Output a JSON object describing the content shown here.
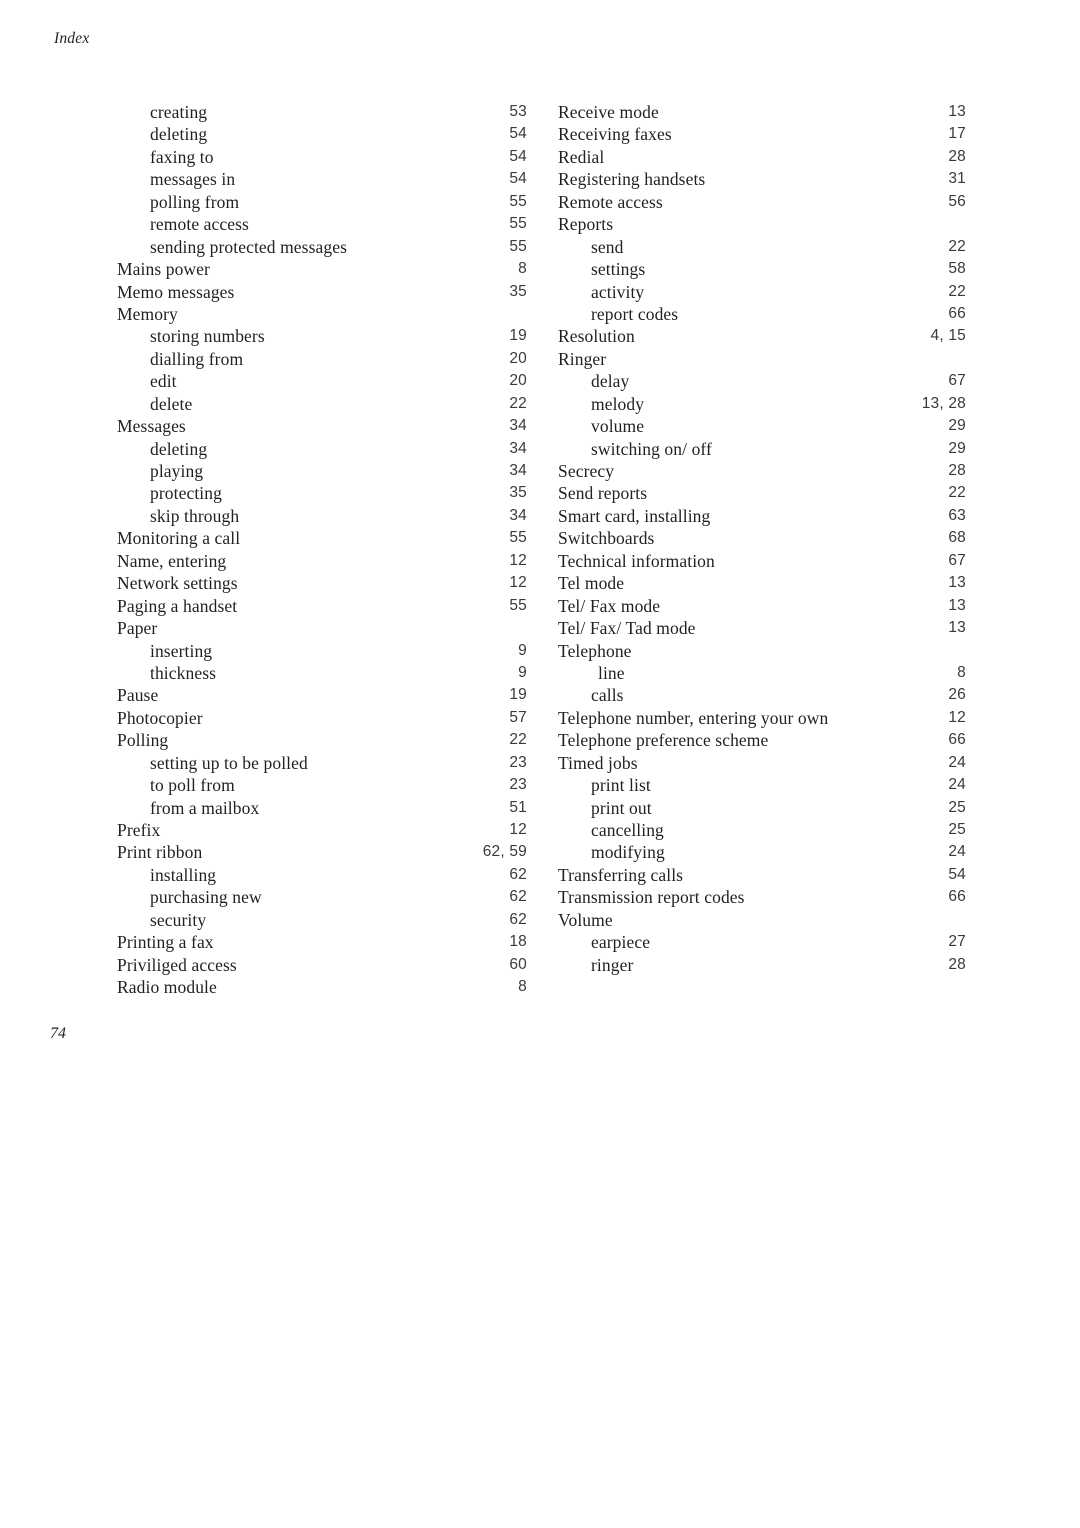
{
  "header": {
    "running_head": "Index"
  },
  "footer": {
    "page_number": "74"
  },
  "index": {
    "left_column": [
      {
        "label": "creating",
        "page": "53",
        "level": 2
      },
      {
        "label": "deleting",
        "page": "54",
        "level": 2
      },
      {
        "label": "faxing to",
        "page": "54",
        "level": 2
      },
      {
        "label": "messages in",
        "page": "54",
        "level": 2
      },
      {
        "label": "polling from",
        "page": "55",
        "level": 2
      },
      {
        "label": "remote access",
        "page": "55",
        "level": 2
      },
      {
        "label": "sending protected messages",
        "page": "55",
        "level": 2
      },
      {
        "label": "Mains power",
        "page": "8",
        "level": 1
      },
      {
        "label": "Memo messages",
        "page": "35",
        "level": 1
      },
      {
        "label": "Memory",
        "page": "",
        "level": 1
      },
      {
        "label": "storing numbers",
        "page": "19",
        "level": 2
      },
      {
        "label": "dialling from",
        "page": "20",
        "level": 2
      },
      {
        "label": "edit",
        "page": "20",
        "level": 2
      },
      {
        "label": "delete",
        "page": "22",
        "level": 2
      },
      {
        "label": "Messages",
        "page": "34",
        "level": 1
      },
      {
        "label": "deleting",
        "page": "34",
        "level": 2
      },
      {
        "label": "playing",
        "page": "34",
        "level": 2
      },
      {
        "label": "protecting",
        "page": "35",
        "level": 2
      },
      {
        "label": "skip through",
        "page": "34",
        "level": 2
      },
      {
        "label": "Monitoring a call",
        "page": "55",
        "level": 1
      },
      {
        "label": "Name, entering",
        "page": "12",
        "level": 1
      },
      {
        "label": "Network settings",
        "page": "12",
        "level": 1
      },
      {
        "label": "Paging a handset",
        "page": "55",
        "level": 1
      },
      {
        "label": "Paper",
        "page": "",
        "level": 1
      },
      {
        "label": "inserting",
        "page": "9",
        "level": 2
      },
      {
        "label": "thickness",
        "page": "9",
        "level": 2
      },
      {
        "label": "Pause",
        "page": "19",
        "level": 1
      },
      {
        "label": "Photocopier",
        "page": "57",
        "level": 1
      },
      {
        "label": "Polling",
        "page": "22",
        "level": 1
      },
      {
        "label": "setting up to be polled",
        "page": "23",
        "level": 2
      },
      {
        "label": "to poll from",
        "page": "23",
        "level": 2
      },
      {
        "label": "from a mailbox",
        "page": "51",
        "level": 2
      },
      {
        "label": "Prefix",
        "page": "12",
        "level": 1
      },
      {
        "label": "Print ribbon",
        "page": "62, 59",
        "level": 1
      },
      {
        "label": "installing",
        "page": "62",
        "level": 2
      },
      {
        "label": "purchasing new",
        "page": "62",
        "level": 2
      },
      {
        "label": "security",
        "page": "62",
        "level": 2
      },
      {
        "label": "Printing a fax",
        "page": "18",
        "level": 1
      },
      {
        "label": "Priviliged access",
        "page": "60",
        "level": 1
      },
      {
        "label": "Radio module",
        "page": "8",
        "level": 1
      }
    ],
    "right_column": [
      {
        "label": "Receive mode",
        "page": "13",
        "level": 1
      },
      {
        "label": "Receiving faxes",
        "page": "17",
        "level": 1
      },
      {
        "label": "Redial",
        "page": "28",
        "level": 1
      },
      {
        "label": "Registering handsets",
        "page": "31",
        "level": 1
      },
      {
        "label": "Remote access",
        "page": "56",
        "level": 1
      },
      {
        "label": "Reports",
        "page": "",
        "level": 1
      },
      {
        "label": "send",
        "page": "22",
        "level": 2
      },
      {
        "label": "settings",
        "page": "58",
        "level": 2
      },
      {
        "label": "activity",
        "page": "22",
        "level": 2
      },
      {
        "label": "report codes",
        "page": "66",
        "level": 2
      },
      {
        "label": "Resolution",
        "page": "4, 15",
        "level": 1
      },
      {
        "label": "Ringer",
        "page": "",
        "level": 1
      },
      {
        "label": "delay",
        "page": "67",
        "level": 2
      },
      {
        "label": "melody",
        "page": "13, 28",
        "level": 2
      },
      {
        "label": "volume",
        "page": "29",
        "level": 2
      },
      {
        "label": "switching on/ off",
        "page": "29",
        "level": 2
      },
      {
        "label": "Secrecy",
        "page": "28",
        "level": 1
      },
      {
        "label": "Send reports",
        "page": "22",
        "level": 1
      },
      {
        "label": "Smart card, installing",
        "page": "63",
        "level": 1
      },
      {
        "label": "Switchboards",
        "page": "68",
        "level": 1
      },
      {
        "label": "Technical information",
        "page": "67",
        "level": 1
      },
      {
        "label": "Tel mode",
        "page": "13",
        "level": 1
      },
      {
        "label": "Tel/ Fax mode",
        "page": "13",
        "level": 1
      },
      {
        "label": "Tel/ Fax/ Tad mode",
        "page": "13",
        "level": 1
      },
      {
        "label": "Telephone",
        "page": "",
        "level": 1
      },
      {
        "label": "line",
        "page": "8",
        "level": 3
      },
      {
        "label": "calls",
        "page": "26",
        "level": 2
      },
      {
        "label": "Telephone number, entering your own",
        "page": "12",
        "level": 1
      },
      {
        "label": "Telephone preference scheme",
        "page": "66",
        "level": 1
      },
      {
        "label": "Timed jobs",
        "page": "24",
        "level": 1
      },
      {
        "label": "print list",
        "page": "24",
        "level": 2
      },
      {
        "label": "print out",
        "page": "25",
        "level": 2
      },
      {
        "label": "cancelling",
        "page": "25",
        "level": 2
      },
      {
        "label": "modifying",
        "page": "24",
        "level": 2
      },
      {
        "label": "Transferring calls",
        "page": "54",
        "level": 1
      },
      {
        "label": "Transmission report codes",
        "page": "66",
        "level": 1
      },
      {
        "label": "Volume",
        "page": "",
        "level": 1
      },
      {
        "label": "earpiece",
        "page": "27",
        "level": 2
      },
      {
        "label": "ringer",
        "page": "28",
        "level": 2
      }
    ]
  }
}
